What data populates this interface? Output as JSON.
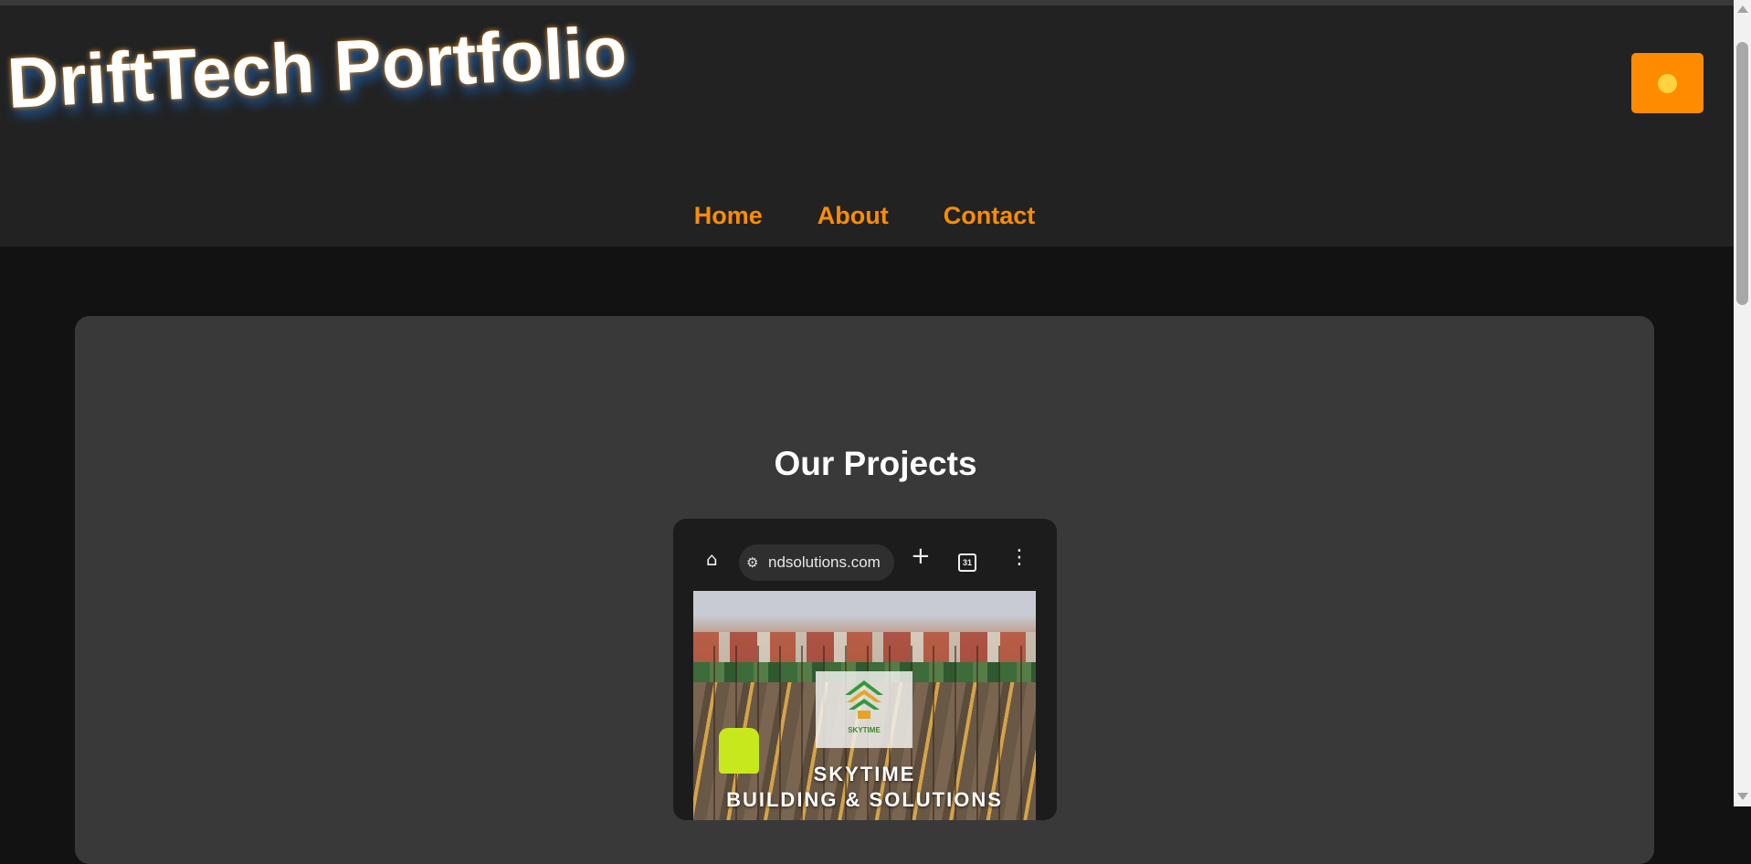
{
  "header": {
    "site_title": "DriftTech Portfolio",
    "theme_toggle_icon": "sun-icon",
    "accent_color": "#ff8c00"
  },
  "nav": {
    "items": [
      {
        "label": "Home"
      },
      {
        "label": "About"
      },
      {
        "label": "Contact"
      }
    ]
  },
  "projects": {
    "heading": "Our Projects",
    "preview": {
      "browser_url": "ndsolutions.com",
      "tab_count": "31",
      "icons": [
        "home-icon",
        "tune-icon",
        "plus-icon",
        "tabs-icon",
        "more-vertical-icon"
      ],
      "image_title": "SKYTIME",
      "image_subtitle": "BUILDING & SOLUTIONS",
      "logo_text": "SKYTIME"
    }
  }
}
